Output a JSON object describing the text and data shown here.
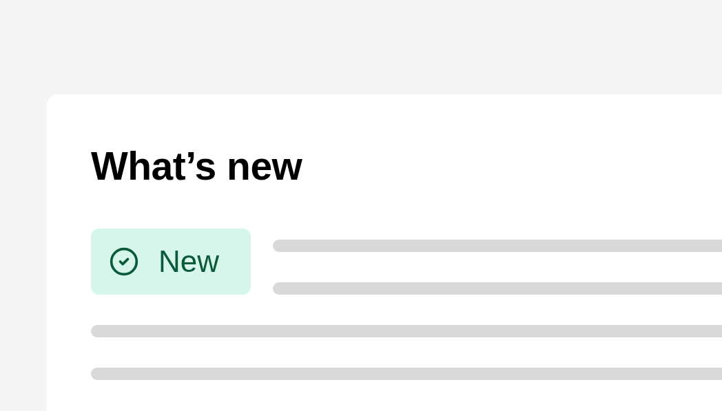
{
  "card": {
    "title": "What’s new",
    "badge": {
      "label": "New"
    }
  }
}
